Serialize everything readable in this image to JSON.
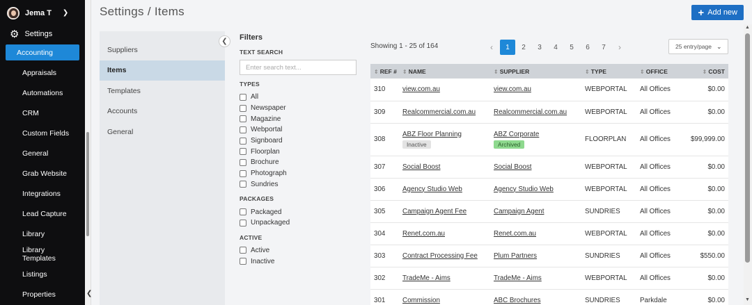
{
  "user": {
    "name": "Jema T"
  },
  "sidebar": {
    "section": "Settings",
    "items": [
      {
        "label": "Accounting",
        "active": true
      },
      {
        "label": "Appraisals"
      },
      {
        "label": "Automations"
      },
      {
        "label": "CRM"
      },
      {
        "label": "Custom Fields"
      },
      {
        "label": "General"
      },
      {
        "label": "Grab Website"
      },
      {
        "label": "Integrations"
      },
      {
        "label": "Lead Capture"
      },
      {
        "label": "Library"
      },
      {
        "label": "Library Templates"
      },
      {
        "label": "Listings"
      },
      {
        "label": "Properties"
      }
    ]
  },
  "header": {
    "title": "Settings / Items",
    "add_button": "Add new"
  },
  "subnav": {
    "items": [
      {
        "label": "Suppliers"
      },
      {
        "label": "Items",
        "active": true
      },
      {
        "label": "Templates"
      },
      {
        "label": "Accounts"
      },
      {
        "label": "General"
      }
    ]
  },
  "filters": {
    "title": "Filters",
    "text_search_label": "TEXT SEARCH",
    "search_placeholder": "Enter search text...",
    "types_label": "TYPES",
    "types": [
      "All",
      "Newspaper",
      "Magazine",
      "Webportal",
      "Signboard",
      "Floorplan",
      "Brochure",
      "Photograph",
      "Sundries"
    ],
    "packages_label": "PACKAGES",
    "packages": [
      "Packaged",
      "Unpackaged"
    ],
    "active_label": "ACTIVE",
    "active": [
      "Active",
      "Inactive"
    ]
  },
  "results": {
    "showing": "Showing 1 - 25 of 164",
    "pages": [
      "1",
      "2",
      "3",
      "4",
      "5",
      "6",
      "7"
    ],
    "current_page": "1",
    "per_page": "25 entry/page"
  },
  "table": {
    "headers": {
      "ref": "REF #",
      "name": "NAME",
      "supplier": "SUPPLIER",
      "type": "TYPE",
      "office": "OFFICE",
      "cost": "COST"
    },
    "rows": [
      {
        "ref": "310",
        "name": "view.com.au",
        "supplier": "view.com.au",
        "type": "WEBPORTAL",
        "office": "All Offices",
        "cost": "$0.00"
      },
      {
        "ref": "309",
        "name": "Realcommercial.com.au",
        "supplier": "Realcommercial.com.au",
        "type": "WEBPORTAL",
        "office": "All Offices",
        "cost": "$0.00"
      },
      {
        "ref": "308",
        "name": "ABZ Floor Planning",
        "name_badge": "Inactive",
        "supplier": "ABZ Corporate",
        "supplier_badge": "Archived",
        "type": "FLOORPLAN",
        "office": "All Offices",
        "cost": "$99,999.00"
      },
      {
        "ref": "307",
        "name": "Social Boost",
        "supplier": "Social Boost",
        "type": "WEBPORTAL",
        "office": "All Offices",
        "cost": "$0.00"
      },
      {
        "ref": "306",
        "name": "Agency Studio Web",
        "supplier": "Agency Studio Web",
        "type": "WEBPORTAL",
        "office": "All Offices",
        "cost": "$0.00"
      },
      {
        "ref": "305",
        "name": "Campaign Agent Fee",
        "supplier": "Campaign Agent",
        "type": "SUNDRIES",
        "office": "All Offices",
        "cost": "$0.00"
      },
      {
        "ref": "304",
        "name": "Renet.com.au",
        "supplier": "Renet.com.au",
        "type": "WEBPORTAL",
        "office": "All Offices",
        "cost": "$0.00"
      },
      {
        "ref": "303",
        "name": "Contract Processing Fee",
        "supplier": "Plum Partners",
        "type": "SUNDRIES",
        "office": "All Offices",
        "cost": "$550.00"
      },
      {
        "ref": "302",
        "name": "TradeMe - Aims",
        "supplier": "TradeMe - Aims",
        "type": "WEBPORTAL",
        "office": "All Offices",
        "cost": "$0.00"
      },
      {
        "ref": "301",
        "name": "Commission",
        "supplier": "ABC Brochures",
        "type": "SUNDRIES",
        "office": "Parkdale",
        "cost": "$0.00"
      }
    ]
  },
  "colors": {
    "accent": "#1e88d8",
    "sidebar_bg": "#0e0e10",
    "button": "#1e6fc4"
  }
}
